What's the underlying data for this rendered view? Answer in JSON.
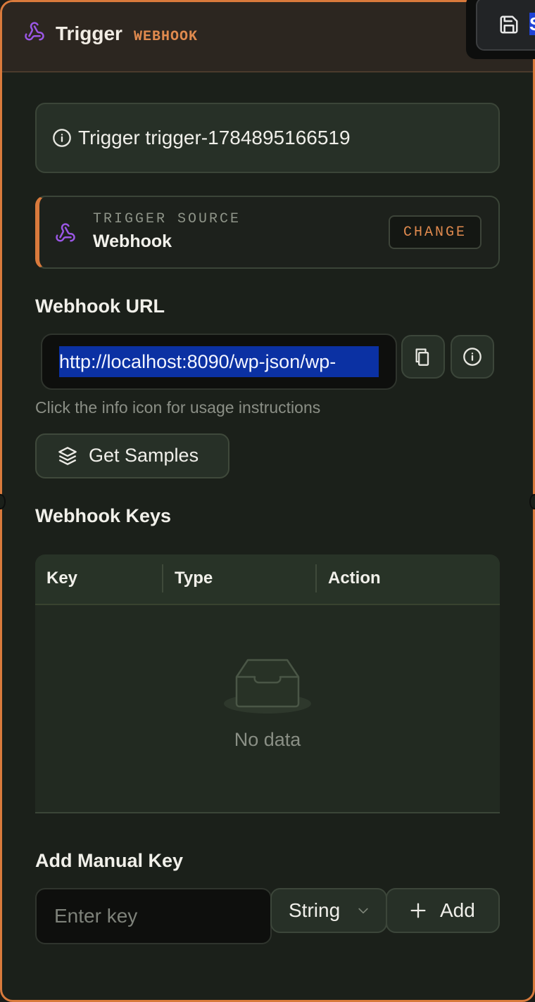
{
  "header": {
    "title": "Trigger",
    "tag": "WEBHOOK",
    "save_label": "S"
  },
  "info": {
    "text": "Trigger trigger-1784895166519"
  },
  "source": {
    "label": "TRIGGER SOURCE",
    "value": "Webhook",
    "change_label": "CHANGE"
  },
  "webhook_url": {
    "section_title": "Webhook URL",
    "value": "http://localhost:8090/wp-json/wp-",
    "hint": "Click the info icon for usage instructions",
    "samples_label": "Get Samples"
  },
  "keys": {
    "section_title": "Webhook Keys",
    "columns": [
      "Key",
      "Type",
      "Action"
    ],
    "empty_text": "No data"
  },
  "manual_key": {
    "section_title": "Add Manual Key",
    "placeholder": "Enter key",
    "type_value": "String",
    "add_label": "Add"
  },
  "colors": {
    "accent": "#d97a3c",
    "tag": "#e08a4e",
    "webhook_icon": "#9b57e6",
    "selection": "#0b31a3"
  },
  "icons": [
    "webhook-icon",
    "save-icon",
    "info-icon",
    "copy-icon",
    "layers-icon",
    "inbox-icon",
    "chevron-down-icon",
    "plus-icon"
  ]
}
